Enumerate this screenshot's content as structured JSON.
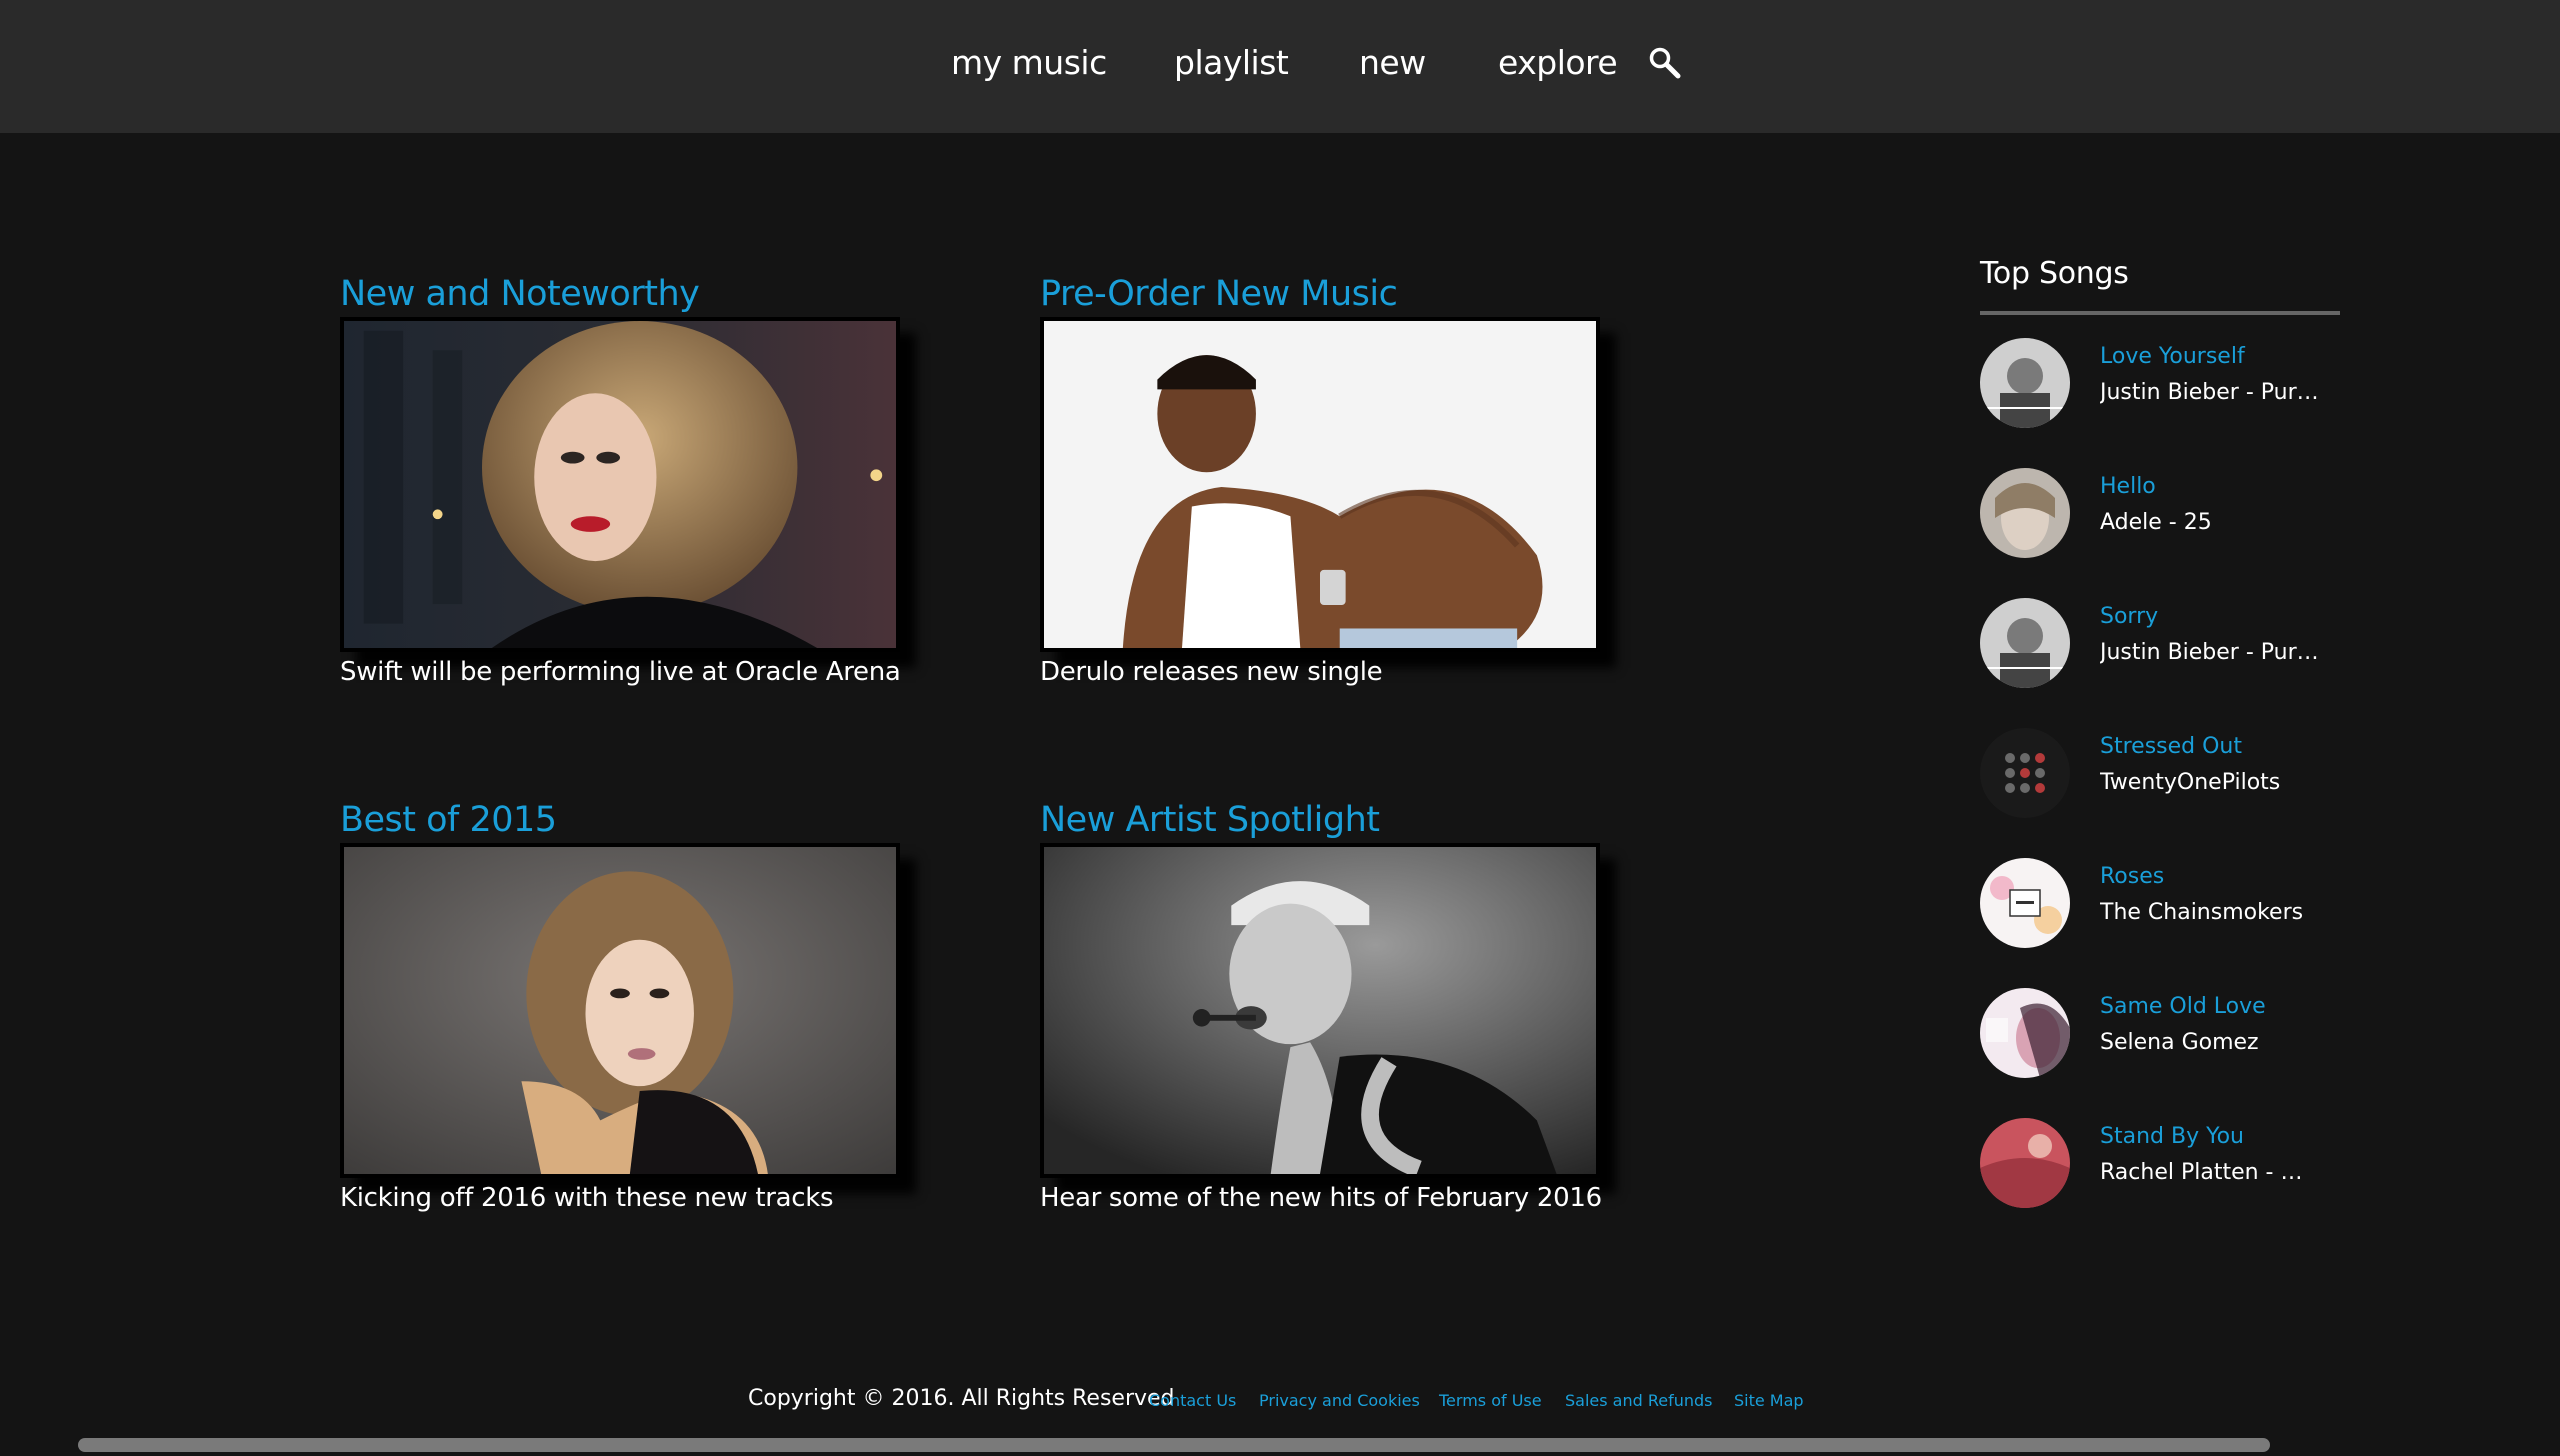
{
  "nav": {
    "items": [
      {
        "label": "my music"
      },
      {
        "label": "playlist"
      },
      {
        "label": "new"
      },
      {
        "label": "explore"
      }
    ],
    "search_icon": "search-icon"
  },
  "features": [
    {
      "title": "New and Noteworthy",
      "caption": "Swift will be performing live at Oracle Arena"
    },
    {
      "title": "Pre-Order New Music",
      "caption": "Derulo releases new single"
    },
    {
      "title": "Best of 2015",
      "caption": "Kicking off 2016 with these new tracks"
    },
    {
      "title": "New Artist Spotlight",
      "caption": "Hear some of the new hits of February 2016"
    }
  ],
  "top_songs": {
    "title": "Top Songs",
    "songs": [
      {
        "title": "Love Yourself",
        "artist": "Justin Bieber - Purp..."
      },
      {
        "title": "Hello",
        "artist": "Adele - 25"
      },
      {
        "title": "Sorry",
        "artist": "Justin Bieber - Purp..."
      },
      {
        "title": "Stressed Out",
        "artist": "TwentyOnePilots"
      },
      {
        "title": "Roses",
        "artist": "The Chainsmokers"
      },
      {
        "title": "Same Old Love",
        "artist": "Selena Gomez"
      },
      {
        "title": "Stand By You",
        "artist": "Rachel Platten - Wil..."
      }
    ]
  },
  "footer": {
    "copyright": "Copyright © 2016. All Rights Reserved",
    "links": [
      {
        "label": "Contact Us"
      },
      {
        "label": "Privacy and Cookies"
      },
      {
        "label": "Terms of Use"
      },
      {
        "label": "Sales and Refunds"
      },
      {
        "label": "Site Map"
      }
    ]
  },
  "colors": {
    "background": "#141414",
    "topbar": "#2a2a2a",
    "accent": "#1a9fd9",
    "text": "#ffffff"
  }
}
